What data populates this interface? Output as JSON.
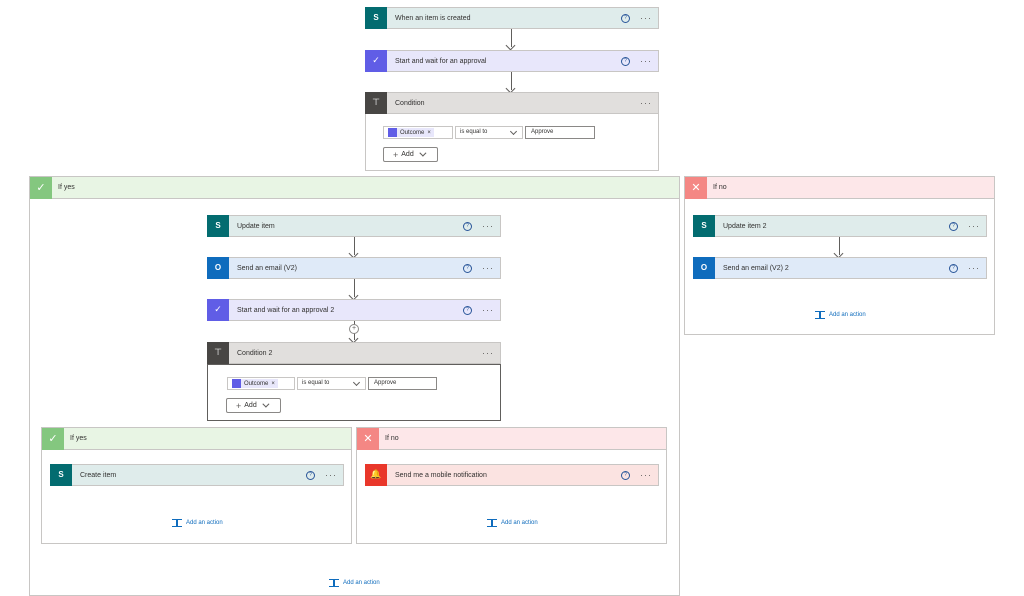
{
  "steps": {
    "trigger": "When an item is created",
    "approval": "Start and wait for an approval",
    "condition": "Condition"
  },
  "condition1": {
    "token": "Outcome",
    "operator": "is equal to",
    "value": "Approve",
    "add_label": "Add"
  },
  "if_yes": {
    "label": "If yes",
    "update_item": "Update item",
    "send_email": "Send an email (V2)",
    "approval2": "Start and wait for an approval 2",
    "condition2": "Condition 2",
    "add_action": "Add an action"
  },
  "condition2": {
    "token": "Outcome",
    "operator": "is equal to",
    "value": "Approve",
    "add_label": "Add"
  },
  "nested_yes": {
    "label": "If yes",
    "create_item": "Create item",
    "add_action": "Add an action"
  },
  "nested_no": {
    "label": "If no",
    "notification": "Send me a mobile notification",
    "add_action": "Add an action"
  },
  "if_no": {
    "label": "If no",
    "update_item2": "Update item 2",
    "send_email2": "Send an email (V2) 2",
    "add_action": "Add an action"
  },
  "icons": {
    "help": "?",
    "more": "···",
    "remove": "×",
    "check": "✓",
    "cross": "✕",
    "plus": "+"
  },
  "colors": {
    "sharepoint": "#036c70",
    "approvals": "#605de6",
    "outlook": "#0f6cbd",
    "condition": "#484644",
    "notification": "#e9372a",
    "yes": "#84c77f",
    "no": "#f48784",
    "link": "#0f6cbd"
  }
}
